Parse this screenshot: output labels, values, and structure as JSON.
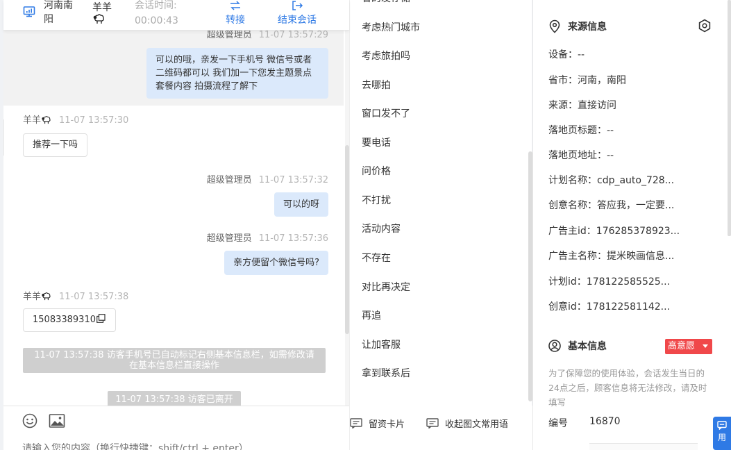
{
  "header": {
    "location": "河南南阳",
    "visitor_name": "羊羊",
    "session_time_label": "会话时间:",
    "session_time_value": "00:00:43",
    "transfer_label": "转接",
    "end_label": "结束会话"
  },
  "messages": [
    {
      "sender": "超级管理员",
      "time": "11-07 13:57:29",
      "text": "可以的哦，亲发一下手机号 微信号或者二维码都可以 我们加一下您发主题景点 套餐内容 拍摄流程了解下"
    },
    {
      "sender": "羊羊",
      "time": "11-07 13:57:30",
      "text": "推荐一下吗"
    },
    {
      "sender": "超级管理员",
      "time": "11-07 13:57:32",
      "text": "可以的呀"
    },
    {
      "sender": "超级管理员",
      "time": "11-07 13:57:36",
      "text": "亲方便留个微信号吗?"
    },
    {
      "sender": "羊羊",
      "time": "11-07 13:57:38",
      "text": "15083389310"
    }
  ],
  "system_notes": {
    "phone_marked": "11-07 13:57:38 访客手机号已自动标记右侧基本信息栏，如需修改请在基本信息栏直接操作",
    "visitor_left": "11-07 13:57:38 访客已离开"
  },
  "input": {
    "placeholder": "请输入您的内容（换行快捷键：shift/ctrl + enter）"
  },
  "quick_replies": {
    "partial_top": "省的发存储",
    "items": [
      "考虑热门城市",
      "考虑旅拍吗",
      "去哪拍",
      "窗口发不了",
      "要电话",
      "问价格",
      "不打扰",
      "活动内容",
      "不存在",
      "对比再决定",
      "再追",
      "让加客服",
      "拿到联系后"
    ],
    "card_label": "留资卡片",
    "fold_label": "收起图文常用语"
  },
  "source_info": {
    "title": "来源信息",
    "rows": [
      {
        "label": "设备：",
        "value": "--"
      },
      {
        "label": "省市：",
        "value": "河南，南阳"
      },
      {
        "label": "来源：",
        "value": "直接访问"
      },
      {
        "label": "落地页标题：",
        "value": "--"
      },
      {
        "label": "落地页地址：",
        "value": "--"
      },
      {
        "label": "计划名称：",
        "value": "cdp_auto_728..."
      },
      {
        "label": "创意名称：",
        "value": "答应我，一定要..."
      },
      {
        "label": "广告主id：",
        "value": "176285378923..."
      },
      {
        "label": "广告主名称：",
        "value": "提米映画信息..."
      },
      {
        "label": "计划id：",
        "value": "178122585525..."
      },
      {
        "label": "创意id：",
        "value": "178122581142..."
      }
    ]
  },
  "basic_info": {
    "title": "基本信息",
    "intent_badge": "高意愿",
    "note": "为了保障您的使用体验，会话发生当日的24点之后，顾客信息将无法修改，请及时填写",
    "id_label": "编号",
    "id_value": "16870"
  },
  "side_tab": {
    "label": "用"
  },
  "colors": {
    "accent": "#2f7ae5",
    "agent_bubble": "#dbe9fb",
    "badge_red": "#f0484a"
  }
}
